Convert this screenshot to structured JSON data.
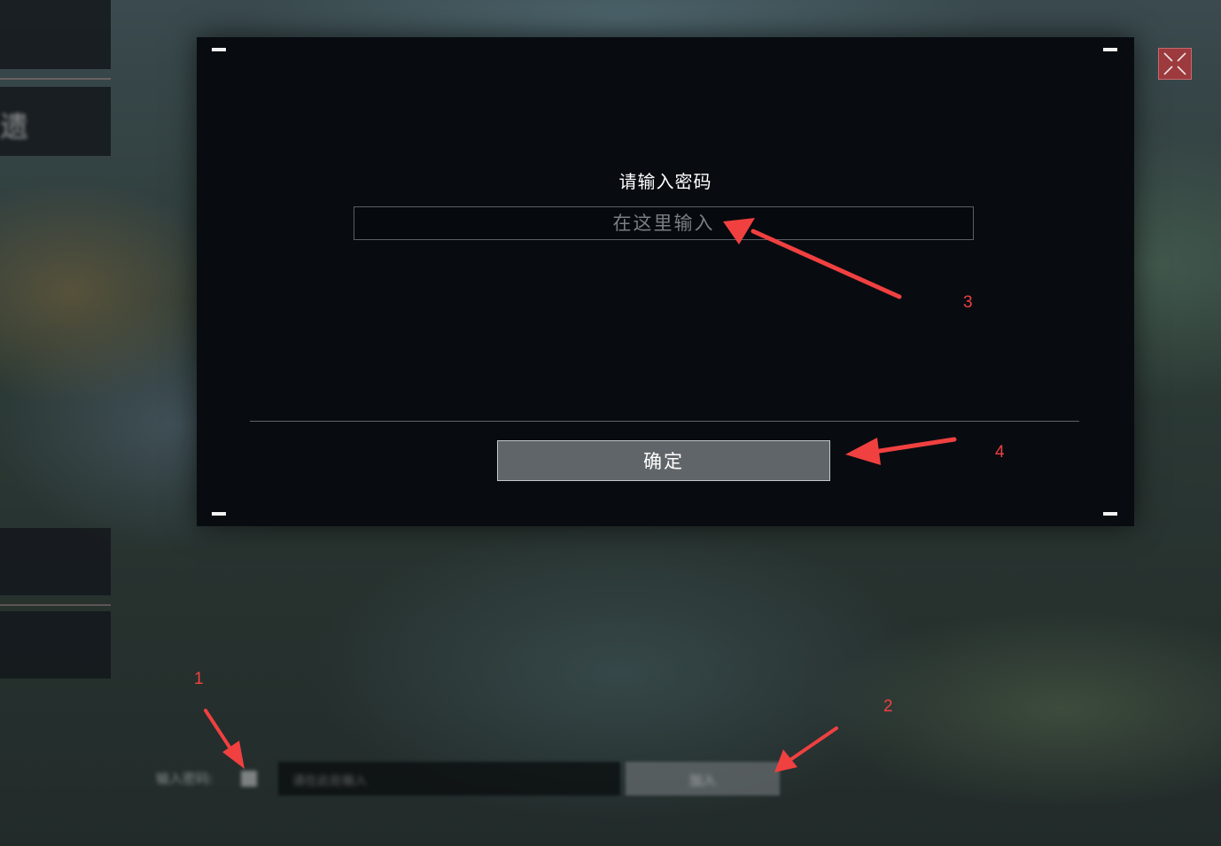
{
  "modal": {
    "title": "请输入密码",
    "password_placeholder": "在这里输入",
    "password_value": "",
    "confirm_label": "确定"
  },
  "background": {
    "side_char": "遗",
    "room_password_label": "输入密码:",
    "room_password_placeholder": "请在此处输入",
    "room_confirm_label": "加入"
  },
  "close_icon": "close-x-icon",
  "annotations": [
    "1",
    "2",
    "3",
    "4"
  ],
  "colors": {
    "modal_bg": "#080c11",
    "button_bg": "#60656a",
    "close_bg": "#9c3a3e",
    "annotation": "#f04040"
  }
}
